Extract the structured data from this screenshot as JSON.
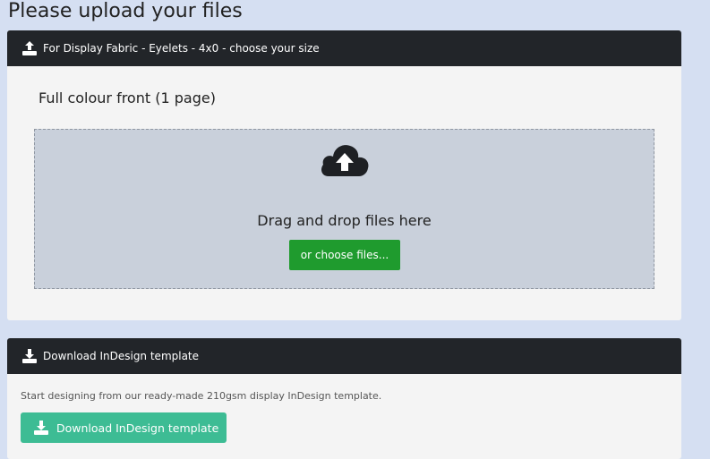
{
  "page": {
    "title": "Please upload your files"
  },
  "upload_panel": {
    "header": "For Display Fabric - Eyelets - 4x0 - choose your size",
    "header_icon": "upload-icon",
    "section_title": "Full colour front (1 page)",
    "dropzone": {
      "icon": "cloud-upload-icon",
      "text": "Drag and drop files here",
      "button_label": "or choose files..."
    }
  },
  "template_panel": {
    "header": "Download InDesign template",
    "header_icon": "download-icon",
    "description": "Start designing from our ready-made 210gsm display InDesign template.",
    "button_label": "Download InDesign template",
    "button_icon": "download-icon"
  },
  "colors": {
    "background": "#d5dff2",
    "header_bg": "#222529",
    "choose_button": "#1f9b2e",
    "download_button": "#3dbc94",
    "dropzone_bg": "#c9d0db"
  }
}
